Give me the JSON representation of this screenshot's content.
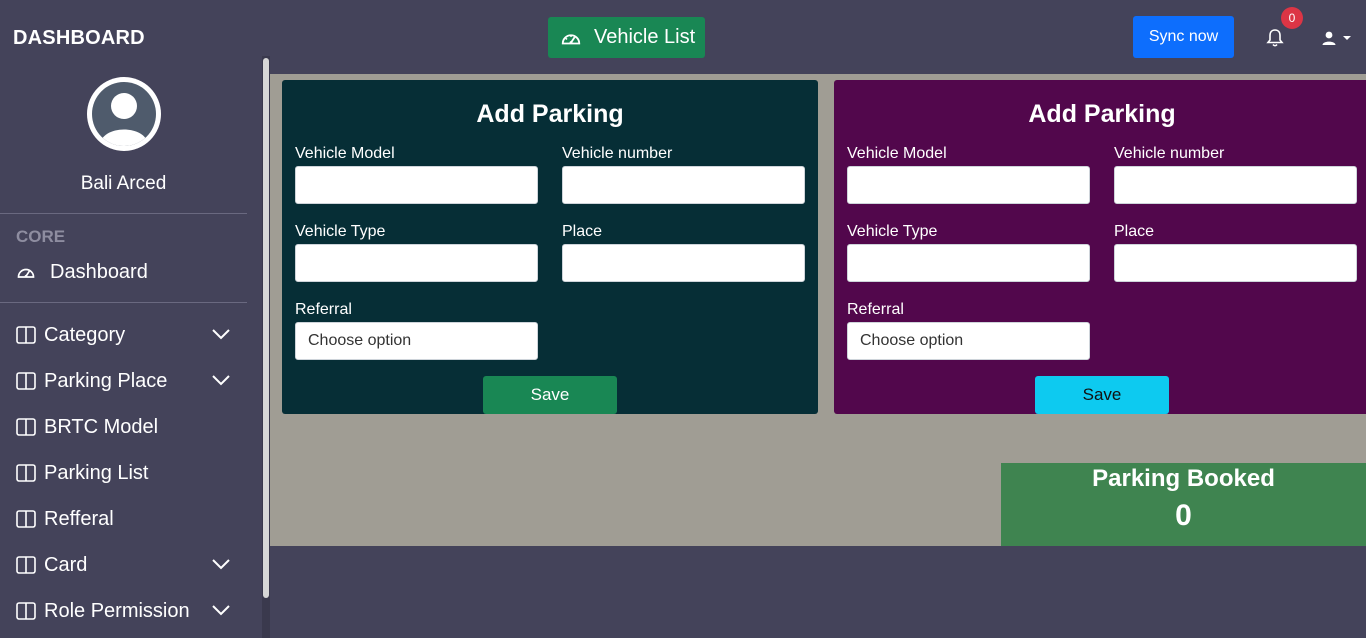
{
  "topbar": {
    "brand": "DASHBOARD",
    "vehicle_list_label": "Vehicle List",
    "sync_label": "Sync now",
    "notification_count": "0"
  },
  "sidebar": {
    "user_name": "Bali Arced",
    "section_core": "CORE",
    "items": [
      {
        "label": "Dashboard",
        "icon": "gauge-icon"
      },
      {
        "label": "Category",
        "icon": "columns-icon",
        "expandable": true
      },
      {
        "label": "Parking Place",
        "icon": "columns-icon",
        "expandable": true
      },
      {
        "label": "BRTC Model",
        "icon": "columns-icon"
      },
      {
        "label": "Parking List",
        "icon": "columns-icon"
      },
      {
        "label": "Refferal",
        "icon": "columns-icon"
      },
      {
        "label": "Card",
        "icon": "columns-icon",
        "expandable": true
      },
      {
        "label": "Role Permission",
        "icon": "columns-icon",
        "expandable": true
      }
    ]
  },
  "forms": [
    {
      "title": "Add Parking",
      "background": "#062e36",
      "vehicle_model_label": "Vehicle Model",
      "vehicle_model_value": "",
      "vehicle_number_label": "Vehicle number",
      "vehicle_number_value": "",
      "vehicle_type_label": "Vehicle Type",
      "vehicle_type_value": "",
      "place_label": "Place",
      "place_value": "",
      "referral_label": "Referral",
      "referral_selected": "Choose option",
      "save_label": "Save",
      "save_color": "#198754"
    },
    {
      "title": "Add Parking",
      "background": "#52074c",
      "vehicle_model_label": "Vehicle Model",
      "vehicle_model_value": "",
      "vehicle_number_label": "Vehicle number",
      "vehicle_number_value": "",
      "vehicle_type_label": "Vehicle Type",
      "vehicle_type_value": "",
      "place_label": "Place",
      "place_value": "",
      "referral_label": "Referral",
      "referral_selected": "Choose option",
      "save_label": "Save",
      "save_color": "#0dcaf0"
    }
  ],
  "stats": {
    "parking_booked_label": "Parking Booked",
    "parking_booked_count": "0"
  }
}
